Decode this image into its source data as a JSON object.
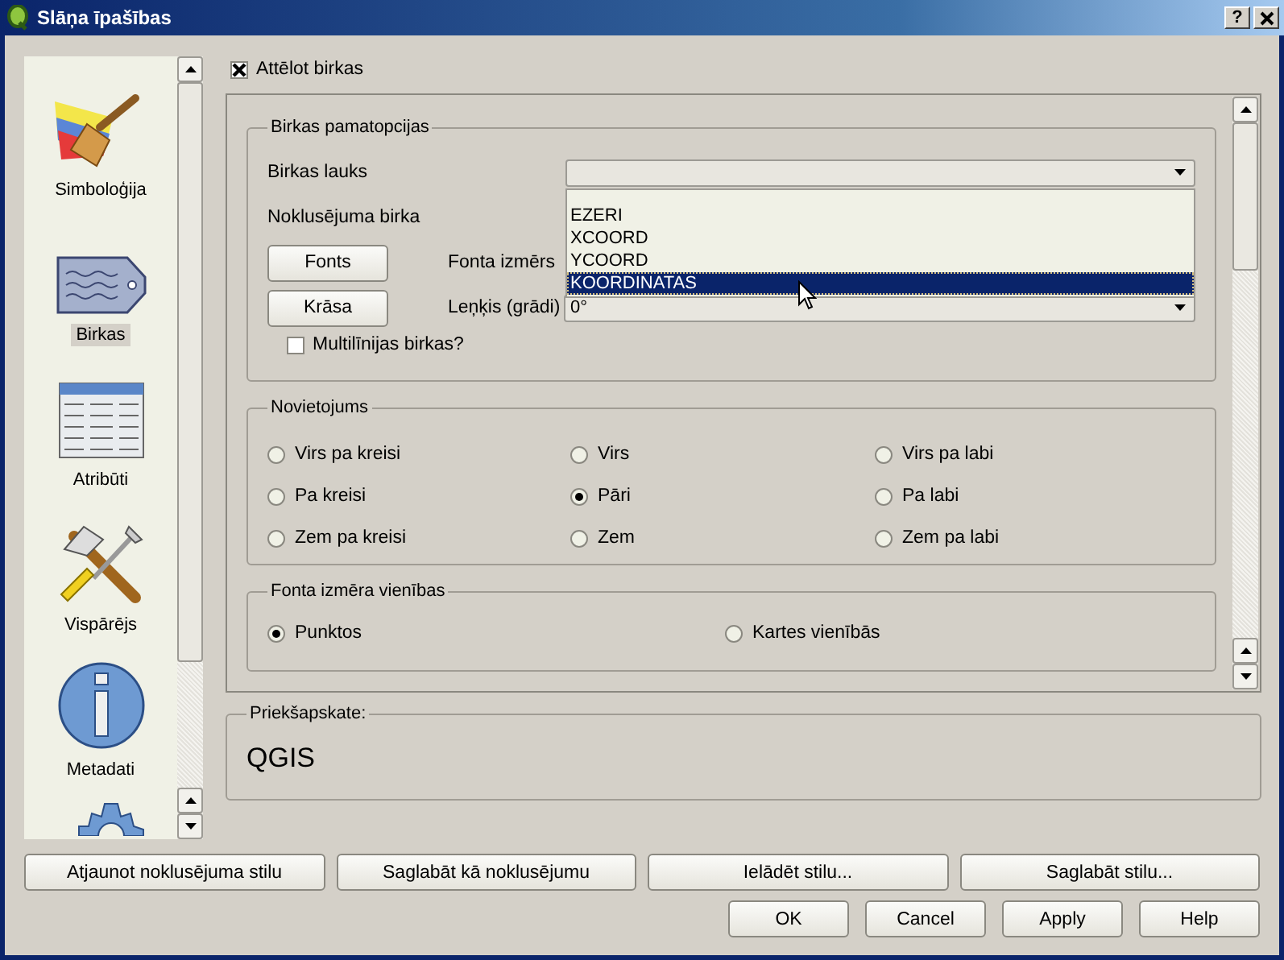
{
  "window": {
    "title": "Slāņa īpašības",
    "help_button": "?"
  },
  "sidebar": {
    "items": [
      {
        "kind": "brush",
        "label": "Simboloģija",
        "selected": false
      },
      {
        "kind": "tag",
        "label": "Birkas",
        "selected": true
      },
      {
        "kind": "table",
        "label": "Atribūti",
        "selected": false
      },
      {
        "kind": "tools",
        "label": "Vispārējs",
        "selected": false
      },
      {
        "kind": "info",
        "label": "Metadati",
        "selected": false
      },
      {
        "kind": "gear"
      }
    ]
  },
  "show_labels": {
    "label": "Attēlot birkas",
    "checked": true
  },
  "label_settings": {
    "title": "Birkas pamatopcijas",
    "field_label": "Birkas lauks",
    "default_label": "Noklusējuma birka",
    "font_button": "Fonts",
    "font_size_label": "Fonta izmērs",
    "color_button": "Krāsa",
    "angle_label": "Leņķis (grādi)",
    "angle_value": "0°",
    "field_dropdown": [
      {
        "label": "EZERI",
        "selected": false
      },
      {
        "label": "XCOORD",
        "selected": false
      },
      {
        "label": "YCOORD",
        "selected": false
      },
      {
        "label": "KOORDINATAS",
        "selected": true
      }
    ],
    "multiline": {
      "label": "Multilīnijas birkas?",
      "checked": false
    }
  },
  "placement": {
    "title": "Novietojums",
    "options": [
      {
        "label": "Virs pa kreisi",
        "selected": false
      },
      {
        "label": "Virs",
        "selected": false
      },
      {
        "label": "Virs pa labi",
        "selected": false
      },
      {
        "label": "Pa kreisi",
        "selected": false
      },
      {
        "label": "Pāri",
        "selected": true
      },
      {
        "label": "Pa labi",
        "selected": false
      },
      {
        "label": "Zem pa kreisi",
        "selected": false
      },
      {
        "label": "Zem",
        "selected": false
      },
      {
        "label": "Zem pa labi",
        "selected": false
      }
    ]
  },
  "font_units": {
    "title": "Fonta izmēra vienības",
    "options": [
      {
        "label": "Punktos",
        "selected": true
      },
      {
        "label": "Kartes vienībās",
        "selected": false
      }
    ]
  },
  "preview": {
    "title": "Priekšapskate:",
    "text": "QGIS"
  },
  "style_buttons": [
    "Atjaunot noklusējuma stilu",
    "Saglabāt kā noklusējumu",
    "Ielādēt stilu...",
    "Saglabāt stilu..."
  ],
  "dialog_buttons": [
    "OK",
    "Cancel",
    "Apply",
    "Help"
  ]
}
